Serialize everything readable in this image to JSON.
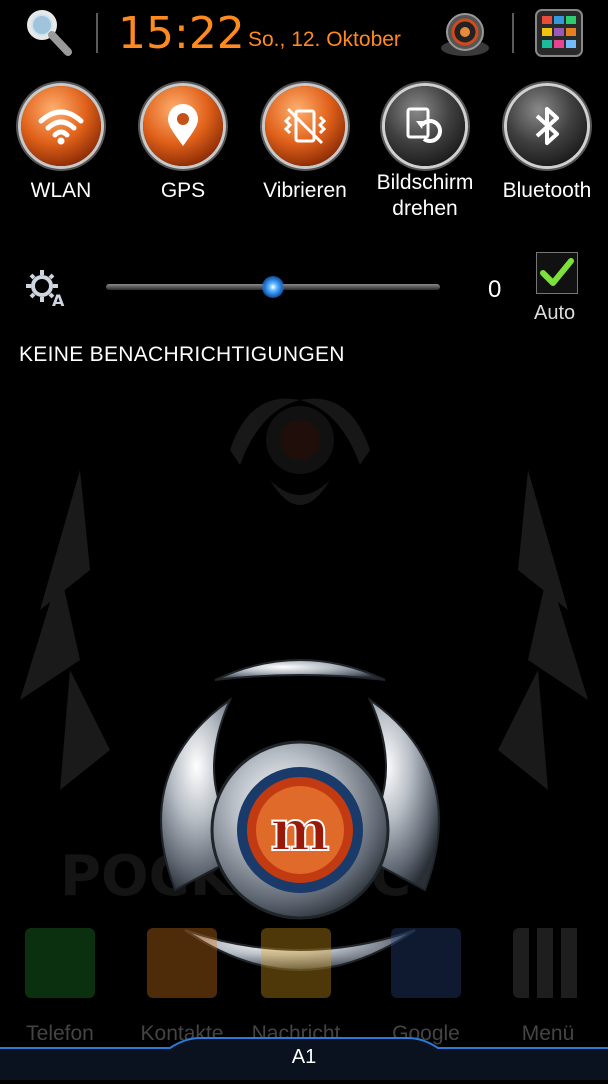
{
  "status": {
    "time": "15:22",
    "date": "So., 12. Oktober"
  },
  "toggles": [
    {
      "label": "WLAN",
      "state": "on",
      "icon": "wifi-icon"
    },
    {
      "label": "GPS",
      "state": "on",
      "icon": "location-pin-icon"
    },
    {
      "label": "Vibrieren",
      "state": "on",
      "icon": "vibrate-icon"
    },
    {
      "label": "Bildschirm drehen",
      "state": "off",
      "icon": "screen-rotate-icon"
    },
    {
      "label": "Bluetooth",
      "state": "off",
      "icon": "bluetooth-icon"
    }
  ],
  "brightness": {
    "value": "0",
    "level": 0.5,
    "auto_label": "Auto",
    "auto_checked": true
  },
  "notifications": {
    "empty_text": "KEINE BENACHRICHTIGUNGEN"
  },
  "dock": [
    {
      "label": "Telefon",
      "icon": "phone-icon"
    },
    {
      "label": "Kontakte",
      "icon": "contacts-icon"
    },
    {
      "label": "Nachricht",
      "icon": "message-icon"
    },
    {
      "label": "Google",
      "icon": "google-folder-icon"
    },
    {
      "label": "Menü",
      "icon": "app-grid-icon"
    }
  ],
  "carrier": "A1",
  "colors": {
    "accent": "#ff8a1f",
    "toggle_on": "#e0611a",
    "toggle_off": "#404040",
    "check": "#7ee03a"
  }
}
